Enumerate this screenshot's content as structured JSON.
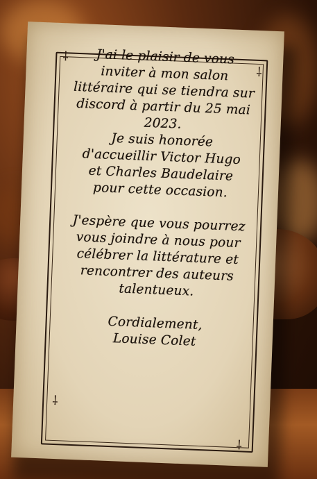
{
  "invitation": {
    "paragraph1": [
      "J'ai le plaisir de vous",
      "inviter à mon salon",
      "littéraire qui se tiendra sur",
      "discord à partir du 25 mai",
      "2023."
    ],
    "paragraph2": [
      "Je suis honorée",
      "d'accueillir Victor Hugo",
      "et Charles Baudelaire",
      "pour cette occasion."
    ],
    "paragraph3": [
      "J'espère que vous pourrez",
      "vous joindre à nous pour",
      "célébrer la littérature et",
      "rencontrer des auteurs",
      "talentueux."
    ],
    "closing": [
      "Cordialement,",
      "Louise Colet"
    ]
  }
}
